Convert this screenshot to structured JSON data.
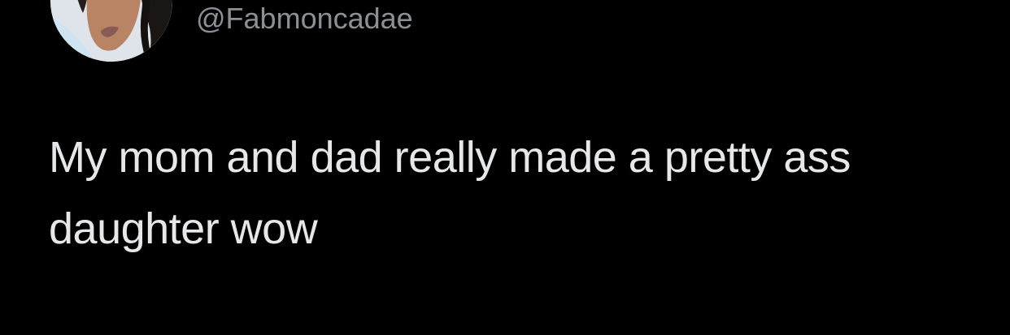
{
  "tweet": {
    "author": {
      "handle": "@Fabmoncadae"
    },
    "text_lines": [
      "My mom and dad really made a pretty ass",
      "daughter wow"
    ]
  },
  "colors": {
    "background": "#000000",
    "handle": "#8b9097",
    "text": "#e6e7e9"
  }
}
